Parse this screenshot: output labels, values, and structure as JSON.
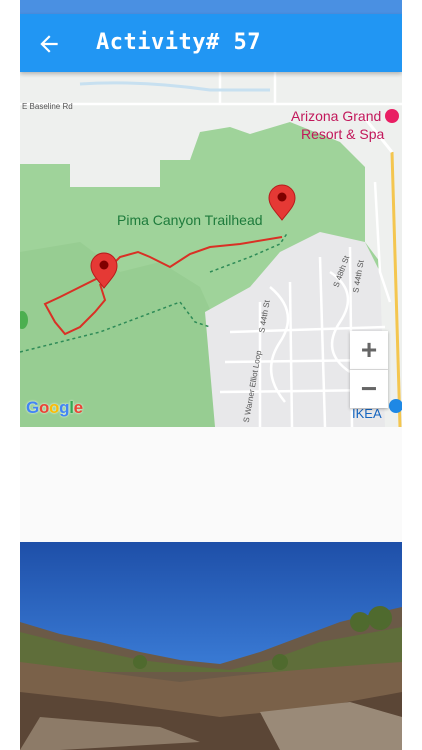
{
  "appbar": {
    "title": "Activity# 57",
    "back_icon": "arrow-back-icon"
  },
  "map": {
    "labels": {
      "trailhead": "Pima Canyon Trailhead",
      "resort_line1": "Arizona Grand",
      "resort_line2": "Resort & Spa",
      "ikea": "IKEA",
      "baseline_rd": "E Baseline Rd",
      "st_44": "S 44th St",
      "st_48": "S 48th St",
      "s_44th": "S 44th St",
      "warner": "S Warner Elliot Loop"
    },
    "zoom_in": "+",
    "zoom_out": "−",
    "google_logo": "Google",
    "colors": {
      "route": "#d93025",
      "park": "#9fd39a",
      "marker": "#e53935"
    }
  },
  "colors": {
    "appbar": "#2196f3",
    "statusbar": "#4a90e2"
  }
}
